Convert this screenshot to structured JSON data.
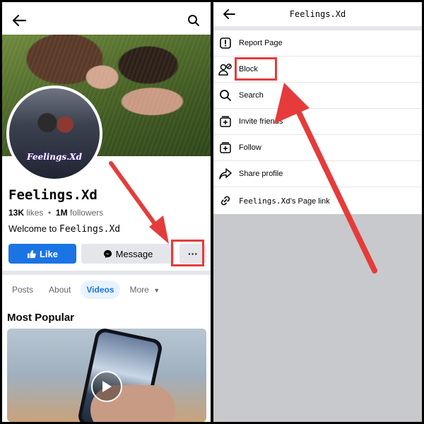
{
  "left": {
    "page_name": "Feelings.Xd",
    "likes_count": "13K",
    "likes_label": "likes",
    "followers_count": "1M",
    "followers_label": "followers",
    "intro_prefix": "Welcome to",
    "intro_name": "Feelings.Xd",
    "avatar_watermark": "Feelings.Xd",
    "like_button": "Like",
    "message_button": "Message",
    "more_button": "···",
    "tabs": [
      {
        "label": "Posts",
        "active": false
      },
      {
        "label": "About",
        "active": false
      },
      {
        "label": "Videos",
        "active": true
      },
      {
        "label": "More",
        "active": false
      }
    ],
    "section_title": "Most Popular"
  },
  "right": {
    "title": "Feelings.Xd",
    "menu": [
      {
        "label": "Report Page",
        "icon": "report-icon"
      },
      {
        "label": "Block",
        "icon": "block-user-icon"
      },
      {
        "label": "Search",
        "icon": "search-icon"
      },
      {
        "label": "Invite friends",
        "icon": "invite-icon"
      },
      {
        "label": "Follow",
        "icon": "follow-icon"
      },
      {
        "label": "Share profile",
        "icon": "share-icon"
      },
      {
        "label_name": "Feelings.Xd",
        "label_suffix": "'s Page link",
        "icon": "link-icon"
      }
    ]
  },
  "colors": {
    "accent": "#1b74e4",
    "annotation": "#e63b3b",
    "button_grey": "#e4e6eb",
    "active_tab_bg": "#e7f3ff"
  }
}
